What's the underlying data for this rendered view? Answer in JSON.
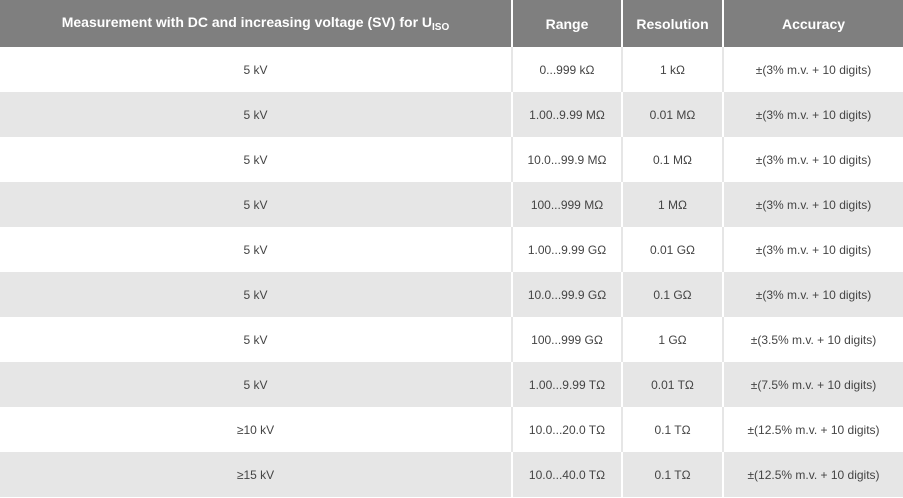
{
  "table": {
    "headers": {
      "measurement": "Measurement with DC and increasing voltage (SV) for U",
      "measurement_sub": "ISO",
      "range": "Range",
      "resolution": "Resolution",
      "accuracy": "Accuracy"
    },
    "rows": [
      {
        "voltage": "5 kV",
        "range": "0...999 kΩ",
        "resolution": "1 kΩ",
        "accuracy": "±(3% m.v. + 10 digits)"
      },
      {
        "voltage": "5 kV",
        "range": "1.00..9.99 MΩ",
        "resolution": "0.01 MΩ",
        "accuracy": "±(3% m.v. + 10 digits)"
      },
      {
        "voltage": "5 kV",
        "range": "10.0...99.9 MΩ",
        "resolution": "0.1 MΩ",
        "accuracy": "±(3% m.v. + 10 digits)"
      },
      {
        "voltage": "5 kV",
        "range": "100...999 MΩ",
        "resolution": "1 MΩ",
        "accuracy": "±(3% m.v. + 10 digits)"
      },
      {
        "voltage": "5 kV",
        "range": "1.00...9.99 GΩ",
        "resolution": "0.01 GΩ",
        "accuracy": "±(3% m.v. + 10 digits)"
      },
      {
        "voltage": "5 kV",
        "range": "10.0...99.9 GΩ",
        "resolution": "0.1 GΩ",
        "accuracy": "±(3% m.v. + 10 digits)"
      },
      {
        "voltage": "5 kV",
        "range": "100...999 GΩ",
        "resolution": "1 GΩ",
        "accuracy": "±(3.5% m.v. + 10 digits)"
      },
      {
        "voltage": "5 kV",
        "range": "1.00...9.99 TΩ",
        "resolution": "0.01 TΩ",
        "accuracy": "±(7.5% m.v. + 10 digits)"
      },
      {
        "voltage": "≥10 kV",
        "range": "10.0...20.0 TΩ",
        "resolution": "0.1 TΩ",
        "accuracy": "±(12.5% m.v. + 10 digits)"
      },
      {
        "voltage": "≥15 kV",
        "range": "10.0...40.0 TΩ",
        "resolution": "0.1 TΩ",
        "accuracy": "±(12.5% m.v. + 10 digits)"
      }
    ]
  }
}
